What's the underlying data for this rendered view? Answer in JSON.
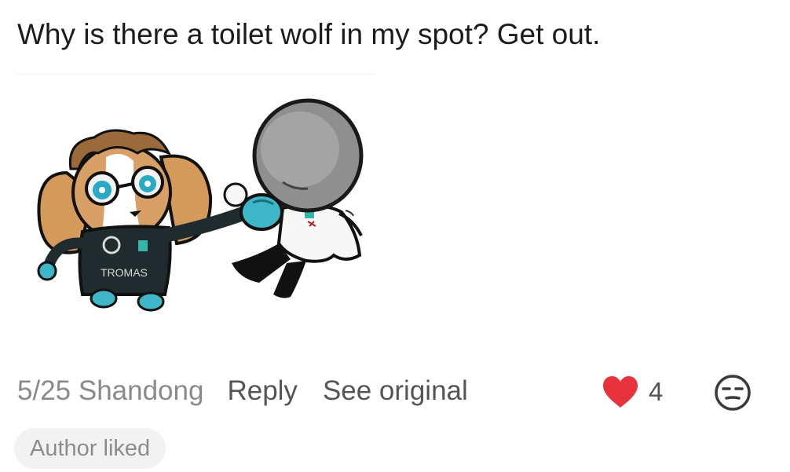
{
  "comment": {
    "text": "Why is there a toilet wolf in my spot? Get out."
  },
  "sticker": {
    "icon": "cartoon-punch-sticker",
    "shirt_text": "TROMAS"
  },
  "meta": {
    "date_location": "5/25 Shandong",
    "reply_label": "Reply",
    "see_original_label": "See original"
  },
  "likes": {
    "count": "4",
    "icon": "heart-icon",
    "color": "#e8323c"
  },
  "reaction": {
    "icon": "expressionless-face-icon"
  },
  "badge": {
    "label": "Author liked"
  }
}
